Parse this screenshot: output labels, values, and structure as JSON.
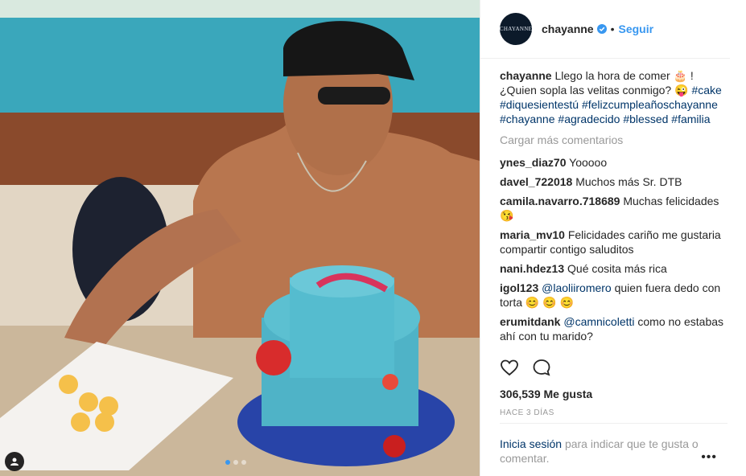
{
  "header": {
    "avatar_text": "CHAYANNE",
    "username": "chayanne",
    "separator": "•",
    "follow_label": "Seguir"
  },
  "caption": {
    "username": "chayanne",
    "text": "Llego la hora de comer 🎂 ! ¿Quien sopla las velitas conmigo? 😜",
    "hashtags": [
      "#cake",
      "#diquesientestú",
      "#felizcumpleañoschayanne",
      "#chayanne",
      "#agradecido",
      "#blessed",
      "#familia"
    ]
  },
  "load_more_label": "Cargar más comentarios",
  "comments": [
    {
      "user": "ynes_diaz70",
      "text": "Yooooo"
    },
    {
      "user": "davel_722018",
      "text": "Muchos más Sr. DTB"
    },
    {
      "user": "camila.navarro.718689",
      "text": "Muchas felicidades 😘"
    },
    {
      "user": "maria_mv10",
      "text": "Felicidades cariño me gustaria compartir contigo saluditos"
    },
    {
      "user": "nani.hdez13",
      "text": "Qué cosita más rica"
    },
    {
      "user": "igol123",
      "mention": "@laoliiromero",
      "text": "quien fuera dedo con torta 😊 😊 😊"
    },
    {
      "user": "erumitdank",
      "mention": "@camnicoletti",
      "text": "como no estabas ahí con tu marido?"
    }
  ],
  "likes_text": "306,539 Me gusta",
  "time_text": "HACE 3 DÍAS",
  "login": {
    "link_text": "Inicia sesión",
    "rest_text": "para indicar que te gusta o comentar."
  },
  "more_icon_text": "•••",
  "colors": {
    "link": "#003569",
    "follow": "#3897f0",
    "muted": "#999999"
  }
}
